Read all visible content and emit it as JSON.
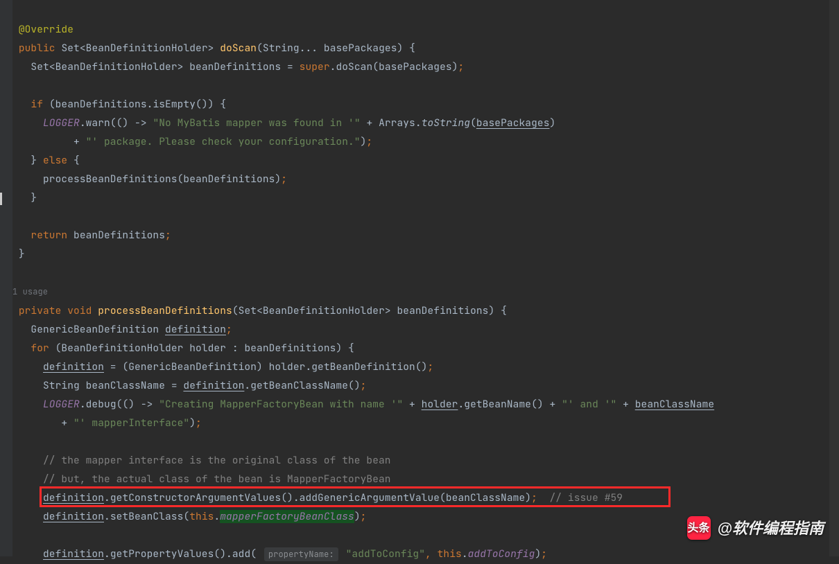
{
  "code": {
    "annotation": "@Override",
    "line1": {
      "kw_public": "public",
      "set": "Set",
      "holder": "BeanDefinitionHolder",
      "method": "doScan",
      "param1": "String... basePackages",
      "brace": " {"
    },
    "line2": {
      "set": "Set",
      "holder": "BeanDefinitionHolder",
      "var": "beanDefinitions",
      "eq": " = ",
      "super": "super",
      "dot": ".",
      "call": "doScan",
      "arg": "basePackages",
      "end": ";"
    },
    "line4": {
      "if": "if",
      "open": " (",
      "var": "beanDefinitions",
      "dot": ".",
      "call": "isEmpty",
      "parens": "()",
      "close": ") {",
      "paren_hl": ")"
    },
    "line5": {
      "logger": "LOGGER",
      "dot": ".",
      "warn": "warn",
      "open": "(",
      "lambda": "() -> ",
      "str1": "\"No MyBatis mapper was found in '\"",
      "plus": " + ",
      "arrays": "Arrays",
      "dot2": ".",
      "toStr": "toString",
      "open2": "(",
      "arg": "basePackages",
      "close2": ")"
    },
    "line6": {
      "indent": "          + ",
      "str": "\"' package. Please check your configuration.\"",
      "end": ");"
    },
    "line7": {
      "brace": "}",
      "else": " else ",
      "brace2": "{"
    },
    "line8": {
      "call": "processBeanDefinitions",
      "open": "(",
      "arg": "beanDefinitions",
      "close": ")",
      "end": ";"
    },
    "line9": {
      "brace": "}"
    },
    "line11": {
      "ret": "return",
      "var": " beanDefinitions",
      "end": ";"
    },
    "line12": {
      "brace": "}"
    },
    "usage": "1 usage",
    "m2": {
      "line1": {
        "private": "private",
        "void": " void ",
        "name": "processBeanDefinitions",
        "open": "(",
        "set": "Set",
        "holder": "BeanDefinitionHolder",
        "param": "beanDefinitions",
        "close": ") {"
      },
      "line2": {
        "type": "GenericBeanDefinition ",
        "var": "definition",
        "end": ";"
      },
      "line3": {
        "for": "for",
        "open": " (",
        "type": "BeanDefinitionHolder ",
        "var": "holder",
        "colon": " : ",
        "iter": "beanDefinitions",
        "close": ") {"
      },
      "line4": {
        "var": "definition",
        "eq": " = (",
        "cast": "GenericBeanDefinition",
        "close": ") ",
        "holder": "holder",
        "dot": ".",
        "call": "getBeanDefinition",
        "end": "();"
      },
      "line5": {
        "type": "String ",
        "var": "beanClassName",
        "eq": " = ",
        "def": "definition",
        "dot": ".",
        "call": "getBeanClassName",
        "end": "();"
      },
      "line6": {
        "logger": "LOGGER",
        "dot": ".",
        "debug": "debug",
        "open": "(",
        "lambda": "() -> ",
        "str1": "\"Creating MapperFactoryBean with name '\"",
        "plus": " + ",
        "holder": "holder",
        "dot2": ".",
        "getBeanName": "getBeanName",
        "parens": "()",
        "plus2": " + ",
        "str2": "\"' and '\"",
        "plus3": " + ",
        "bcn": "beanClassName"
      },
      "line7": {
        "indent": "        + ",
        "str": "\"' mapperInterface\"",
        "end": ");"
      },
      "c1": "// the mapper interface is the original class of the bean",
      "c2": "// but, the actual class of the bean is MapperFactoryBean",
      "line10": {
        "def": "definition",
        "dot": ".",
        "call1": "getConstructorArgumentValues",
        "p1": "()",
        "dot2": ".",
        "call2": "addGenericArgumentValue",
        "open": "(",
        "arg": "beanClassName",
        "close": ")",
        "end": ";",
        "comment": "  // issue #59"
      },
      "line11": {
        "def": "definition",
        "dot": ".",
        "call": "setBeanClass",
        "open": "(",
        "this": "this",
        "dot2": ".",
        "field": "mapperFactoryBeanClass",
        "close": ")",
        "end": ";"
      },
      "line13": {
        "def": "definition",
        "dot": ".",
        "call1": "getPropertyValues",
        "p1": "()",
        "dot2": ".",
        "call2": "add",
        "open": "(",
        "inlay": "propertyName:",
        "str": "\"addToConfig\"",
        "comma": ", ",
        "this": "this",
        "dot3": ".",
        "field": "addToConfig",
        "close": ")",
        "end": ";"
      }
    }
  },
  "watermark": {
    "icon": "头条",
    "text": "@软件编程指南"
  }
}
